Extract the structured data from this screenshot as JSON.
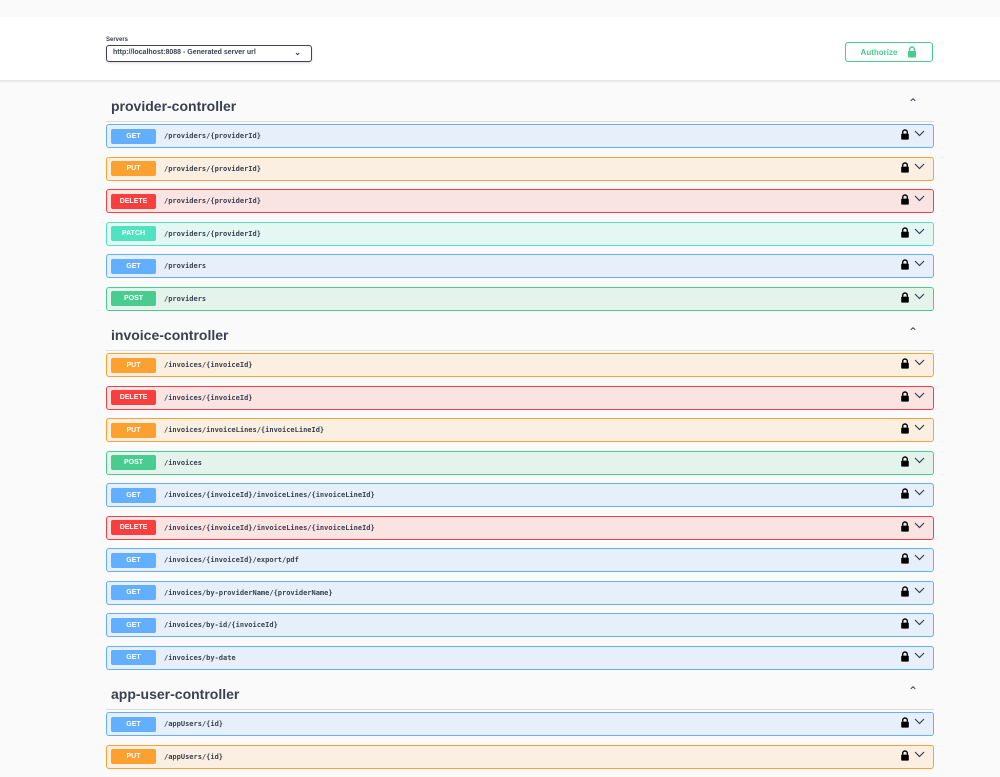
{
  "servers": {
    "label": "Servers",
    "selected": "http://localhost:8088 - Generated server url"
  },
  "authorize": {
    "label": "Authorize"
  },
  "colors": {
    "get": "#61affe",
    "put": "#fca130",
    "delete": "#f93e3e",
    "patch": "#50e3c2",
    "post": "#49cc90"
  },
  "tags": [
    {
      "name": "provider-controller",
      "operations": [
        {
          "method": "GET",
          "path": "/providers/{providerId}"
        },
        {
          "method": "PUT",
          "path": "/providers/{providerId}"
        },
        {
          "method": "DELETE",
          "path": "/providers/{providerId}"
        },
        {
          "method": "PATCH",
          "path": "/providers/{providerId}"
        },
        {
          "method": "GET",
          "path": "/providers"
        },
        {
          "method": "POST",
          "path": "/providers"
        }
      ]
    },
    {
      "name": "invoice-controller",
      "operations": [
        {
          "method": "PUT",
          "path": "/invoices/{invoiceId}"
        },
        {
          "method": "DELETE",
          "path": "/invoices/{invoiceId}"
        },
        {
          "method": "PUT",
          "path": "/invoices/invoiceLines/{invoiceLineId}"
        },
        {
          "method": "POST",
          "path": "/invoices"
        },
        {
          "method": "GET",
          "path": "/invoices/{invoiceId}/invoiceLines/{invoiceLineId}"
        },
        {
          "method": "DELETE",
          "path": "/invoices/{invoiceId}/invoiceLines/{invoiceLineId}"
        },
        {
          "method": "GET",
          "path": "/invoices/{invoiceId}/export/pdf"
        },
        {
          "method": "GET",
          "path": "/invoices/by-providerName/{providerName}"
        },
        {
          "method": "GET",
          "path": "/invoices/by-id/{invoiceId}"
        },
        {
          "method": "GET",
          "path": "/invoices/by-date"
        }
      ]
    },
    {
      "name": "app-user-controller",
      "operations": [
        {
          "method": "GET",
          "path": "/appUsers/{id}"
        },
        {
          "method": "PUT",
          "path": "/appUsers/{id}"
        }
      ]
    }
  ]
}
